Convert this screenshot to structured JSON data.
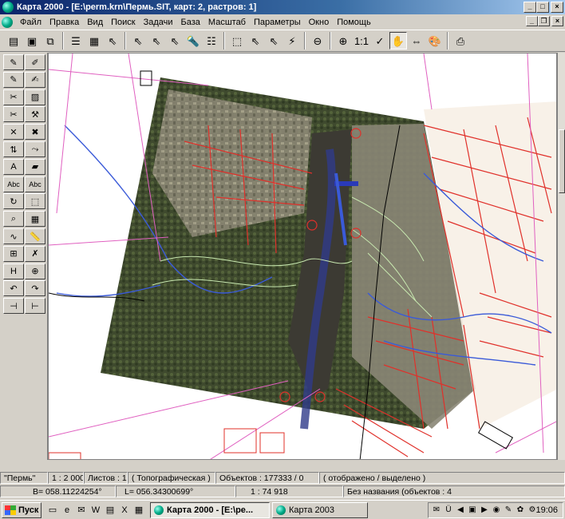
{
  "window": {
    "title": "Карта 2000 - [E:\\perm.krn\\Пермь.SIT, карт: 2, растров: 1]"
  },
  "menu": {
    "items": [
      "Файл",
      "Правка",
      "Вид",
      "Поиск",
      "Задачи",
      "База",
      "Масштаб",
      "Параметры",
      "Окно",
      "Помощь"
    ]
  },
  "toolbar": {
    "items": [
      {
        "name": "new-map-icon",
        "glyph": "▤"
      },
      {
        "name": "open-icon",
        "glyph": "▣"
      },
      {
        "name": "copy-icon",
        "glyph": "⧉"
      },
      {
        "name": "layers-icon",
        "glyph": "☰"
      },
      {
        "name": "save-icon",
        "glyph": "▦"
      },
      {
        "name": "select-icon",
        "glyph": "⇖"
      },
      {
        "name": "select-add-icon",
        "glyph": "⇖"
      },
      {
        "name": "select-remove-icon",
        "glyph": "⇖"
      },
      {
        "name": "select-point-icon",
        "glyph": "⇖"
      },
      {
        "name": "flashlight-icon",
        "glyph": "🔦"
      },
      {
        "name": "list-icon",
        "glyph": "☷"
      },
      {
        "name": "frame-select-icon",
        "glyph": "⬚"
      },
      {
        "name": "select-frame-icon",
        "glyph": "⇖"
      },
      {
        "name": "deselect-icon",
        "glyph": "⇖"
      },
      {
        "name": "flash-icon",
        "glyph": "⚡"
      },
      {
        "name": "zoom-out-icon",
        "glyph": "⊖"
      },
      {
        "name": "zoom-in-icon",
        "glyph": "⊕"
      },
      {
        "name": "zoom-1-1-icon",
        "glyph": "1:1"
      },
      {
        "name": "check-icon",
        "glyph": "✓"
      },
      {
        "name": "hand-icon",
        "glyph": "✋"
      },
      {
        "name": "move-icon",
        "glyph": "⇔"
      },
      {
        "name": "palette-icon",
        "glyph": "🎨"
      },
      {
        "name": "print-icon",
        "glyph": "⎙"
      }
    ]
  },
  "palette": {
    "items": [
      {
        "name": "pen-icon",
        "glyph": "✎"
      },
      {
        "name": "line-pen-icon",
        "glyph": "✐"
      },
      {
        "name": "edit-pen-icon",
        "glyph": "✎"
      },
      {
        "name": "pen-green-icon",
        "glyph": "✍"
      },
      {
        "name": "cut-icon",
        "glyph": "✂"
      },
      {
        "name": "area-icon",
        "glyph": "▨"
      },
      {
        "name": "scissors-icon",
        "glyph": "✂"
      },
      {
        "name": "tools-icon",
        "glyph": "⚒"
      },
      {
        "name": "delete-icon",
        "glyph": "✕"
      },
      {
        "name": "delete-point-icon",
        "glyph": "✖"
      },
      {
        "name": "arrows-icon",
        "glyph": "⇅"
      },
      {
        "name": "branch-icon",
        "glyph": "⤳"
      },
      {
        "name": "text-a-icon",
        "glyph": "A"
      },
      {
        "name": "eraser-icon",
        "glyph": "▰"
      },
      {
        "name": "text-abc-icon",
        "glyph": "Abc"
      },
      {
        "name": "text-abc-frame-icon",
        "glyph": "Abc"
      },
      {
        "name": "rotate-icon",
        "glyph": "↻"
      },
      {
        "name": "select-box-icon",
        "glyph": "⬚"
      },
      {
        "name": "zoom-region-icon",
        "glyph": "⌕"
      },
      {
        "name": "table-icon",
        "glyph": "▦"
      },
      {
        "name": "curve-icon",
        "glyph": "∿"
      },
      {
        "name": "ruler-icon",
        "glyph": "📏"
      },
      {
        "name": "grid-icon",
        "glyph": "⊞"
      },
      {
        "name": "cross-icon",
        "glyph": "✗"
      },
      {
        "name": "height-icon",
        "glyph": "H"
      },
      {
        "name": "globe-add-icon",
        "glyph": "⊕"
      },
      {
        "name": "undo-icon",
        "glyph": "↶"
      },
      {
        "name": "redo-icon",
        "glyph": "↷"
      },
      {
        "name": "snap-icon",
        "glyph": "⊣"
      },
      {
        "name": "align-icon",
        "glyph": "⊢"
      }
    ]
  },
  "status": {
    "map_name": "\"Пермь\"",
    "scale": "1 : 2 000",
    "sheets": "Листов : 1",
    "map_type": "( Топографическая )",
    "objects": "Объектов : 177333 / 0",
    "objects_note": "( отображено / выделено )",
    "coord_b": "B= 058.11224254°",
    "coord_l": "L= 056.34300699°",
    "current_scale": "1 : 74 918",
    "selection": "Без названия  (объектов : 4"
  },
  "taskbar": {
    "start_label": "Пуск",
    "quick_launch": [
      {
        "name": "desktop-icon",
        "glyph": "▭"
      },
      {
        "name": "ie-icon",
        "glyph": "e"
      },
      {
        "name": "outlook-icon",
        "glyph": "✉"
      },
      {
        "name": "word-icon",
        "glyph": "W"
      },
      {
        "name": "explorer-icon",
        "glyph": "▤"
      },
      {
        "name": "excel-icon",
        "glyph": "X"
      },
      {
        "name": "calc-icon",
        "glyph": "▦"
      }
    ],
    "tasks": [
      {
        "label": "Карта 2000 - [E:\\pe...",
        "active": true
      },
      {
        "label": "Карта 2003",
        "active": false
      }
    ],
    "tray": [
      {
        "name": "mail-icon",
        "glyph": "✉"
      },
      {
        "name": "tray-a-icon",
        "glyph": "Ü"
      },
      {
        "name": "volume-icon",
        "glyph": "◀"
      },
      {
        "name": "tray-b-icon",
        "glyph": "▣"
      },
      {
        "name": "media-icon",
        "glyph": "▶"
      },
      {
        "name": "antivirus-icon",
        "glyph": "◉"
      },
      {
        "name": "tray-c-icon",
        "glyph": "✎"
      },
      {
        "name": "tray-d-icon",
        "glyph": "✿"
      },
      {
        "name": "tray-e-icon",
        "glyph": "⚙"
      }
    ],
    "clock": "19:06"
  },
  "colors": {
    "titlebar_start": "#0a246a",
    "titlebar_end": "#a6caf0",
    "chrome": "#d4d0c8",
    "map_bg": "#ffffff",
    "roads": "#e8403a",
    "water": "#3a5ad8",
    "contours": "#c8e8b0"
  }
}
